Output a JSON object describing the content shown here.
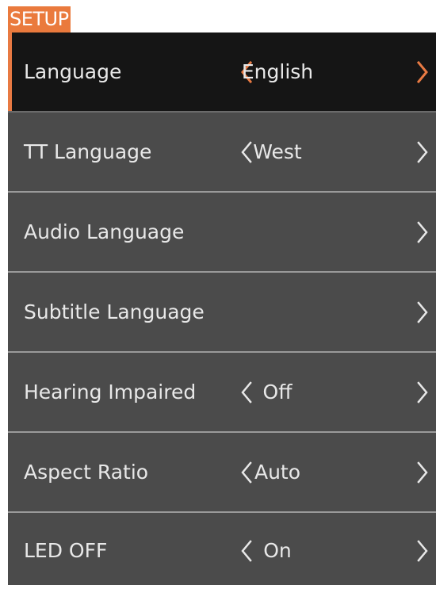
{
  "header": {
    "title": "SETUP"
  },
  "colors": {
    "accent": "#ea7a3d",
    "selected_row_bg": "#151515",
    "row_bg": "#4b4b4b",
    "divider": "#9a9a9a",
    "text": "#e8e8e8"
  },
  "menu": {
    "items": [
      {
        "label": "Language",
        "value": "English",
        "has_left_arrow": true,
        "has_right_arrow": true,
        "selected": true
      },
      {
        "label": "TT Language",
        "value": "West",
        "has_left_arrow": true,
        "has_right_arrow": true,
        "selected": false
      },
      {
        "label": "Audio Language",
        "value": "",
        "has_left_arrow": false,
        "has_right_arrow": true,
        "selected": false
      },
      {
        "label": "Subtitle Language",
        "value": "",
        "has_left_arrow": false,
        "has_right_arrow": true,
        "selected": false
      },
      {
        "label": "Hearing Impaired",
        "value": "Off",
        "has_left_arrow": true,
        "has_right_arrow": true,
        "selected": false
      },
      {
        "label": "Aspect Ratio",
        "value": "Auto",
        "has_left_arrow": true,
        "has_right_arrow": true,
        "selected": false
      },
      {
        "label": "LED OFF",
        "value": "On",
        "has_left_arrow": true,
        "has_right_arrow": true,
        "selected": false
      }
    ]
  },
  "icons": {
    "left": "chevron-left-icon",
    "right": "chevron-right-icon"
  }
}
